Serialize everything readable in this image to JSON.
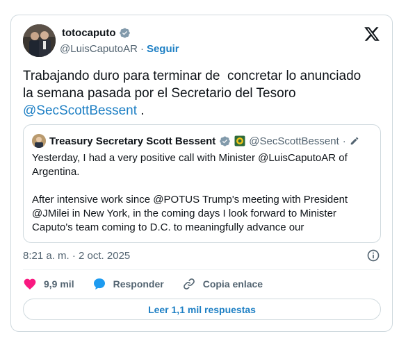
{
  "author": {
    "display_name": "totocaputo",
    "handle": "@LuisCaputoAR",
    "separator": "·",
    "follow_label": "Seguir"
  },
  "tweet": {
    "text_line1": "Trabajando duro para terminar de  concretar lo anunciado",
    "text_line2": "la semana pasada por el Secretario del Tesoro",
    "mention": "@SecScottBessent",
    "text_end": " ."
  },
  "quote": {
    "display_name": "Treasury Secretary Scott Bessent",
    "handle": "@SecScottBessent",
    "separator": "·",
    "body": "Yesterday, I had a very positive call with Minister @LuisCaputoAR of Argentina.\n\nAfter intensive work since @POTUS Trump's meeting with President @JMilei in New York, in the coming days I look forward to Minister Caputo's team coming to D.C. to meaningfully advance our"
  },
  "meta": {
    "timestamp": "8:21 a. m. · 2 oct. 2025"
  },
  "actions": {
    "likes": "9,9 mil",
    "reply_label": "Responder",
    "copy_link_label": "Copia enlace"
  },
  "read_replies_label": "Leer 1,1 mil respuestas",
  "colors": {
    "accent": "#1d7fc4",
    "heart": "#f91880",
    "verified": "#829aab",
    "muted": "#536471"
  },
  "icons": {
    "verified": "verified-badge-icon",
    "logo": "x-logo-icon",
    "info": "info-icon",
    "heart": "heart-icon",
    "reply": "speech-bubble-icon",
    "link": "link-icon",
    "edit": "pencil-icon",
    "gov_badge": "government-badge-icon"
  }
}
